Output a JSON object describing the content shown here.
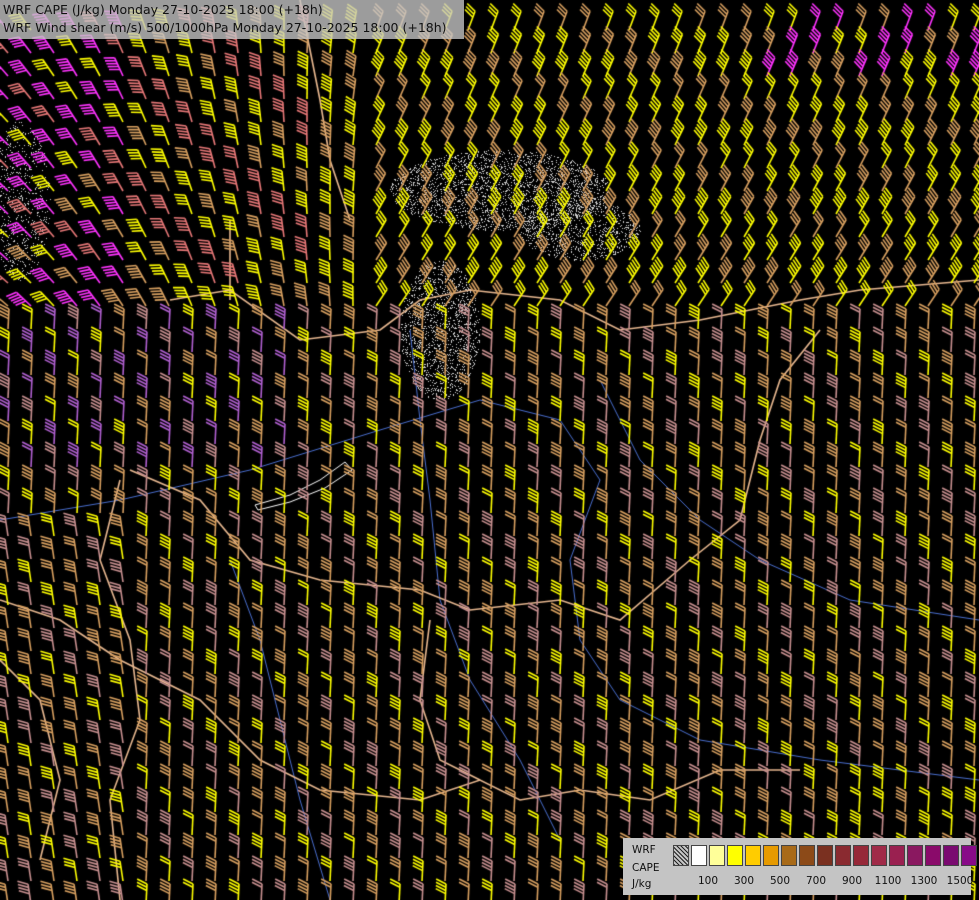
{
  "header": {
    "title_line1": "WRF CAPE (J/kg) Monday 27-10-2025 18:00 (+18h)",
    "title_line2": "WRF Wind shear (m/s) 500/1000hPa Monday 27-10-2025 18:00 (+18h)"
  },
  "legend": {
    "model": "WRF",
    "field": "CAPE",
    "unit": "J/kg",
    "tick_labels": [
      "100",
      "300",
      "500",
      "700",
      "900",
      "1100",
      "1300",
      "1500"
    ],
    "swatch_colors": [
      "#ffffff",
      "#ffff99",
      "#ffff00",
      "#ffcc00",
      "#e69a00",
      "#a86a18",
      "#8c4a18",
      "#7a3020",
      "#8a2a30",
      "#962838",
      "#a02a48",
      "#9a2050",
      "#8a1860",
      "#8a0a6a",
      "#7a0a70",
      "#880a88"
    ],
    "nodata_pattern": "stipple"
  },
  "map": {
    "background": "#000000",
    "border_color": "#e8b890",
    "river_color": "#4a6fd0",
    "barb_colors": [
      "#ff33ff",
      "#e87878",
      "#ffff00",
      "#d8a060",
      "#c89090",
      "#b060d0"
    ]
  }
}
